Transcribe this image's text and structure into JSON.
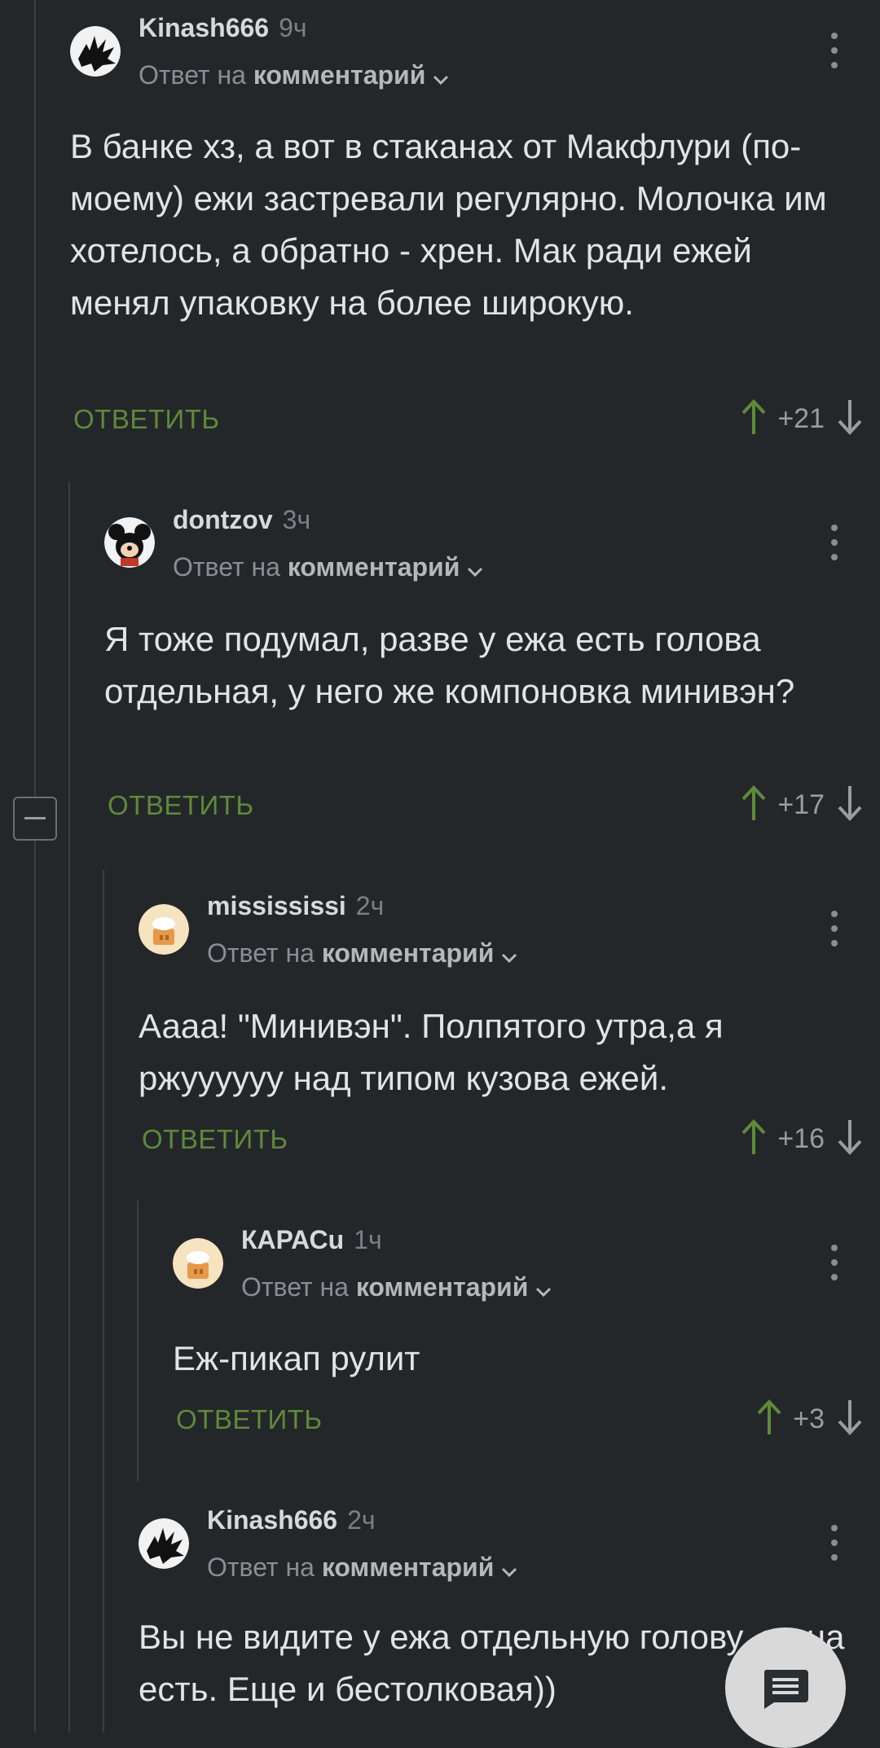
{
  "comments": [
    {
      "author": "Kinash666",
      "time": "9ч",
      "reply_prefix": "Ответ на",
      "reply_target": "комментарий",
      "text": "В банке хз, а вот в стаканах от Макфлури (по-моему) ежи застревали регулярно. Молочка им хотелось, а обратно - хрен. Мак ради ежей менял упаковку на более широкую.",
      "reply_label": "ОТВЕТИТЬ",
      "score": "+21"
    },
    {
      "author": "dontzov",
      "time": "3ч",
      "reply_prefix": "Ответ на",
      "reply_target": "комментарий",
      "text": "Я тоже подумал, разве у ежа есть голова отдельная, у него же компоновка минивэн?",
      "reply_label": "ОТВЕТИТЬ",
      "score": "+17"
    },
    {
      "author": "missississi",
      "time": "2ч",
      "reply_prefix": "Ответ на",
      "reply_target": "комментарий",
      "text": "Аааа!  \"Минивэн\".   Полпятого утра,а я ржуууууу над типом кузова ежей.",
      "reply_label": "ОТВЕТИТЬ",
      "score": "+16"
    },
    {
      "author": "КАРАСu",
      "time": "1ч",
      "reply_prefix": "Ответ на",
      "reply_target": "комментарий",
      "text": "Еж-пикап рулит",
      "reply_label": "ОТВЕТИТЬ",
      "score": "+3"
    },
    {
      "author": "Kinash666",
      "time": "2ч",
      "reply_prefix": "Ответ на",
      "reply_target": "комментарий",
      "text": "Вы не видите у ежа отдельную голову, а она есть. Еще и бестолковая))"
    }
  ],
  "colors": {
    "background": "#24272a",
    "reply_green": "#5f8a3a",
    "upvote_green": "#5f8a3a",
    "muted": "#8a8e92"
  },
  "icons": {
    "more": "more-vertical-icon",
    "up": "arrow-up-icon",
    "down": "arrow-down-icon",
    "chevron": "chevron-down-icon",
    "collapse": "minus-box-icon",
    "fab": "comment-icon"
  }
}
